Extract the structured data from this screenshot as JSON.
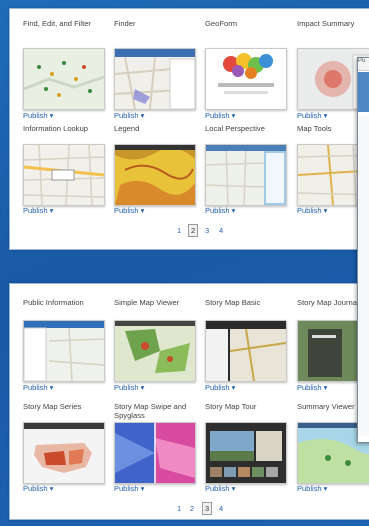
{
  "gallery_top": {
    "items": [
      {
        "title": "Find, Edit, and Filter",
        "publish": "Publish ▾",
        "thumb": "map-with-pins"
      },
      {
        "title": "Finder",
        "publish": "Publish ▾",
        "thumb": "street-map-with-panel"
      },
      {
        "title": "GeoForm",
        "publish": "Publish ▾",
        "thumb": "colorful-form"
      },
      {
        "title": "Impact Summary",
        "publish": "Publish ▾",
        "thumb": "impact-map"
      },
      {
        "title": "Information Lookup",
        "publish": "Publish ▾",
        "thumb": "street-map"
      },
      {
        "title": "Legend",
        "publish": "Publish ▾",
        "thumb": "yellow-heat-map"
      },
      {
        "title": "Local Perspective",
        "publish": "Publish ▾",
        "thumb": "coastal-map"
      },
      {
        "title": "Map Tools",
        "publish": "Publish ▾",
        "thumb": "road-map"
      }
    ],
    "pagination": {
      "pages": [
        "1",
        "2",
        "3",
        "4"
      ],
      "current": "2"
    }
  },
  "gallery_bottom": {
    "items": [
      {
        "title": "Public Information",
        "publish": "Publish ▾",
        "thumb": "blue-ui-map"
      },
      {
        "title": "Simple Map Viewer",
        "publish": "Publish ▾",
        "thumb": "green-map"
      },
      {
        "title": "Story Map Basic",
        "publish": "Publish ▾",
        "thumb": "dark-story-map"
      },
      {
        "title": "Story Map Journal",
        "publish": "Publish ▾",
        "thumb": "journal-map"
      },
      {
        "title": "Story Map Series",
        "publish": "Publish ▾",
        "thumb": "us-choropleth"
      },
      {
        "title": "Story Map Swipe and Spyglass",
        "publish": "Publish ▾",
        "thumb": "swipe-map"
      },
      {
        "title": "Story Map Tour",
        "publish": "Publish ▾",
        "thumb": "photo-tour"
      },
      {
        "title": "Summary Viewer",
        "publish": "Publish ▾",
        "thumb": "summary-map"
      }
    ],
    "pagination": {
      "pages": [
        "1",
        "2",
        "3",
        "4"
      ],
      "current": "3"
    }
  },
  "dialog": {
    "header_text": "Pu"
  }
}
